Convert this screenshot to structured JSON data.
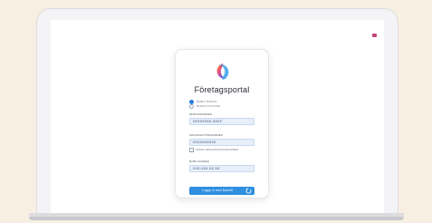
{
  "portal": {
    "title": "Företagsportal",
    "auth_options": [
      {
        "label": "MOBILT BANKID",
        "checked": true
      },
      {
        "label": "BANKID PÅ DATOR",
        "checked": false
      }
    ],
    "fields": {
      "personnummer": {
        "label": "PERSONNUMMER",
        "value": "XXXXXXXX-XXXX"
      },
      "organisationsnummer": {
        "label": "ORGANISATIONSNUMMER",
        "value": "XXXXXXXXXX",
        "checkbox_label": "SPARA ORGANISATIONSNUMMER"
      },
      "mobilnummer": {
        "label": "MOBILNUMMER",
        "value": "XXX-XXX XX XX"
      }
    },
    "login_button": "Logga in med BankID"
  },
  "colors": {
    "background": "#f8efe3",
    "accent": "#2f8fe0",
    "field_bg": "#e6effa"
  }
}
